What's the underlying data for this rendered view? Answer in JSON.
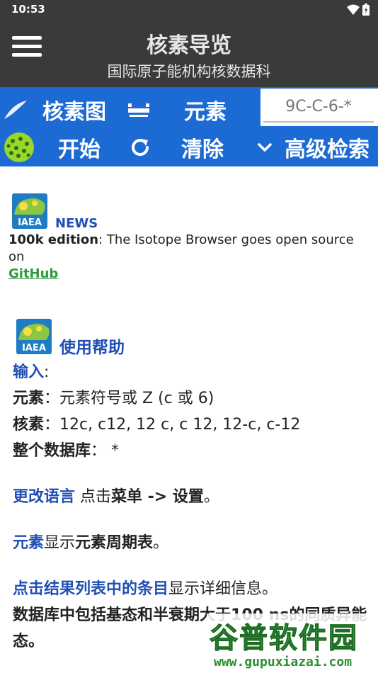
{
  "status": {
    "time": "10:53"
  },
  "appbar": {
    "title": "核素导览",
    "subtitle": "国际原子能机构核数据科"
  },
  "toolbar1": {
    "nuclide_chart_label": "核素图",
    "elements_label": "元素"
  },
  "search": {
    "value": "",
    "placeholder": "9C-C-6-*"
  },
  "toolbar2": {
    "start_label": "开始",
    "clear_label": "清除",
    "advanced_label": "高级检索"
  },
  "news": {
    "logo_text": "IAEA",
    "label": "NEWS",
    "bold_text": "100k edition",
    "text": ": The Isotope Browser goes open source on",
    "link": "GitHub"
  },
  "help": {
    "logo_text": "IAEA",
    "title": "使用帮助",
    "input_label": "输入",
    "input_colon": ":",
    "element_label": "元素",
    "element_text": "：元素符号或 Z (c 或 6)",
    "nuclide_label": "核素",
    "nuclide_text": "：12c, c12, 12 c, c 12, 12-c, c-12",
    "database_label": "整个数据库",
    "database_text": "：  *",
    "language_link": "更改语言",
    "language_text1": " 点击",
    "language_bold": "菜单 -> 设置",
    "language_text2": "。",
    "elements_link": "元素",
    "elements_text1": "显示",
    "elements_bold": "元素周期表",
    "elements_text2": "。",
    "click_link": "点击结果列表中的条目",
    "click_text": "显示详细信息。",
    "db_bold1": "数据库中包括基态和半衰期大于",
    "db_bold2": "100 ns",
    "db_bold3": "的同质异能态。"
  },
  "watermark": {
    "main": "谷普软件园",
    "url": "www.gupuxiazai.com"
  },
  "colors": {
    "appbar": "#3a3a3a",
    "toolbar": "#1c6ad4",
    "link": "#1f4fb5",
    "github": "#2e9b3c"
  }
}
